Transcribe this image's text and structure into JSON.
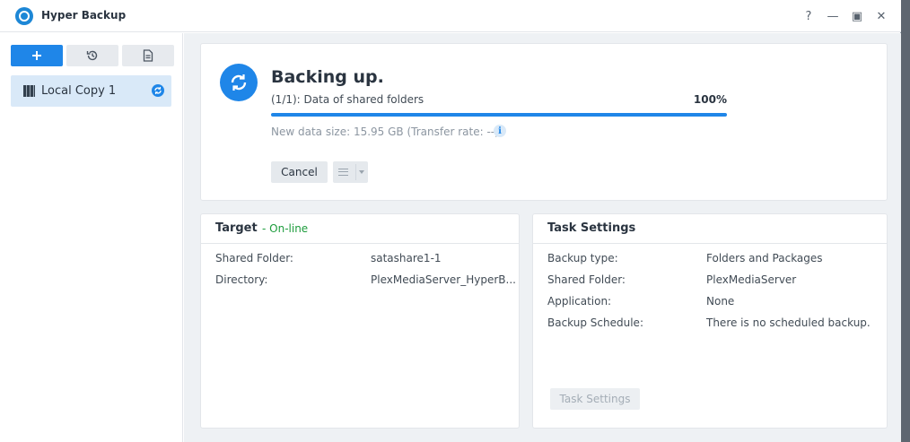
{
  "window": {
    "title": "Hyper Backup",
    "help": "?",
    "minimize": "—",
    "maximize": "▣",
    "close": "✕"
  },
  "toolbar": {
    "add_icon": "plus-icon",
    "restore_icon": "history-icon",
    "log_icon": "document-icon"
  },
  "sidebar": {
    "tasks": [
      {
        "label": "Local Copy 1",
        "icon": "local-copy-icon",
        "status_icon": "syncing-icon"
      }
    ]
  },
  "status": {
    "title": "Backing up.",
    "progress_label": "(1/1): Data of shared folders",
    "progress_pct_text": "100%",
    "progress_fraction": 1.0,
    "data_size": "New data size: 15.95 GB (Transfer rate: --)",
    "cancel_label": "Cancel"
  },
  "target": {
    "title": "Target",
    "status": "- On-line",
    "rows": [
      {
        "label": "Shared Folder:",
        "value": "satashare1-1"
      },
      {
        "label": "Directory:",
        "value": "PlexMediaServer_HyperB..."
      }
    ]
  },
  "task_settings": {
    "title": "Task Settings",
    "rows": [
      {
        "label": "Backup type:",
        "value": "Folders and Packages"
      },
      {
        "label": "Shared Folder:",
        "value": "PlexMediaServer"
      },
      {
        "label": "Application:",
        "value": "None"
      },
      {
        "label": "Backup Schedule:",
        "value": "There is no scheduled backup."
      }
    ],
    "button_label": "Task Settings"
  },
  "colors": {
    "accent": "#1f86e8",
    "online": "#1d9c3c"
  }
}
